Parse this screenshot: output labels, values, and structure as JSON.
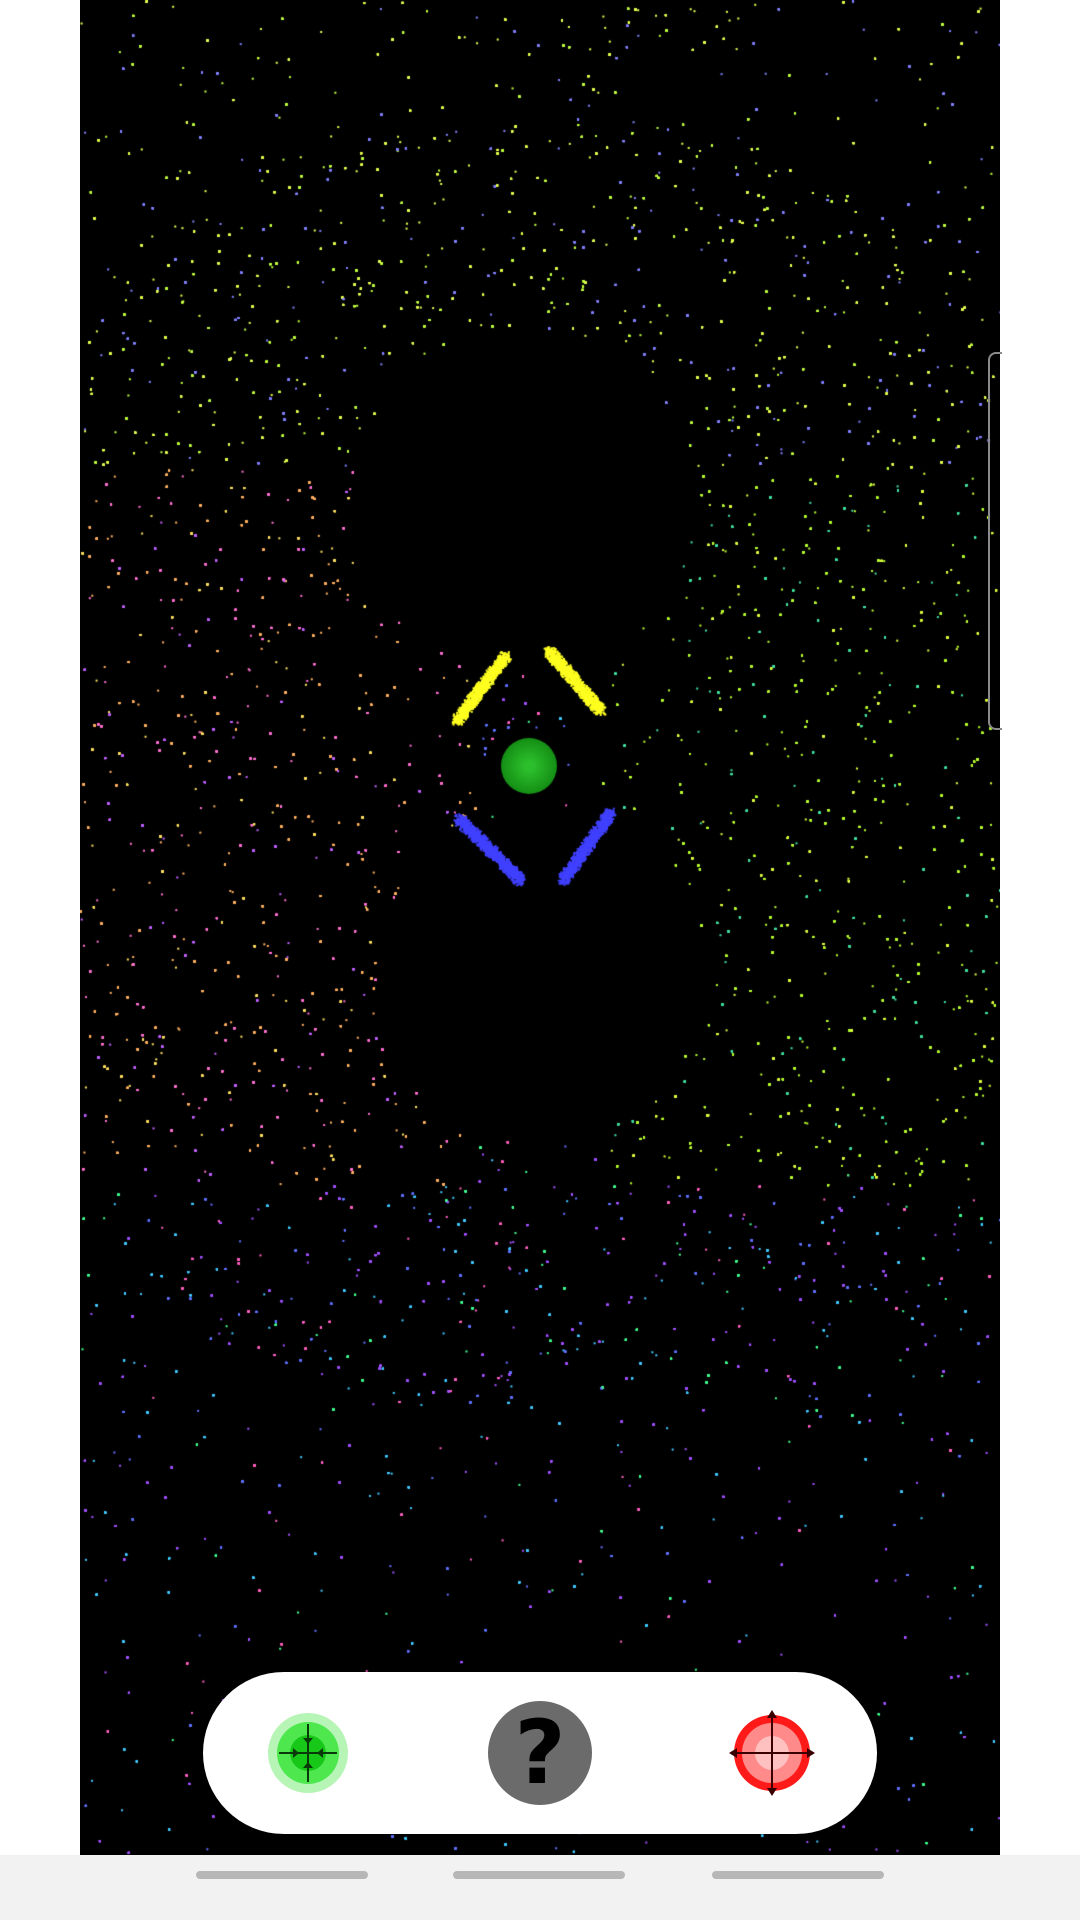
{
  "app": {
    "name": "particle-field-simulation"
  },
  "scene": {
    "background_color": "#000000",
    "particle_colors": [
      "#ffff40",
      "#b8ff40",
      "#40ff80",
      "#40c8ff",
      "#6060ff",
      "#b040ff",
      "#ff60c0",
      "#ffb060",
      "#ffffff"
    ],
    "bodies": [
      {
        "name": "green-orb",
        "color": "#1fa01f",
        "kind": "attractor"
      },
      {
        "name": "yellow-arc-pair",
        "color": "#ffff20",
        "kind": "particle-cluster"
      },
      {
        "name": "blue-arc-pair",
        "color": "#4040ff",
        "kind": "particle-cluster"
      }
    ]
  },
  "toolbar": {
    "buttons": [
      {
        "id": "attractor",
        "icon": "green-attractor-target-icon",
        "color": "#22dd22"
      },
      {
        "id": "help",
        "icon": "question-mark-icon",
        "label": "?",
        "color": "#6b6b6b"
      },
      {
        "id": "repeller",
        "icon": "red-repeller-target-icon",
        "color": "#ff1a1a"
      }
    ]
  },
  "navigation_bar": {
    "style": "gesture-pills",
    "count": 3
  }
}
